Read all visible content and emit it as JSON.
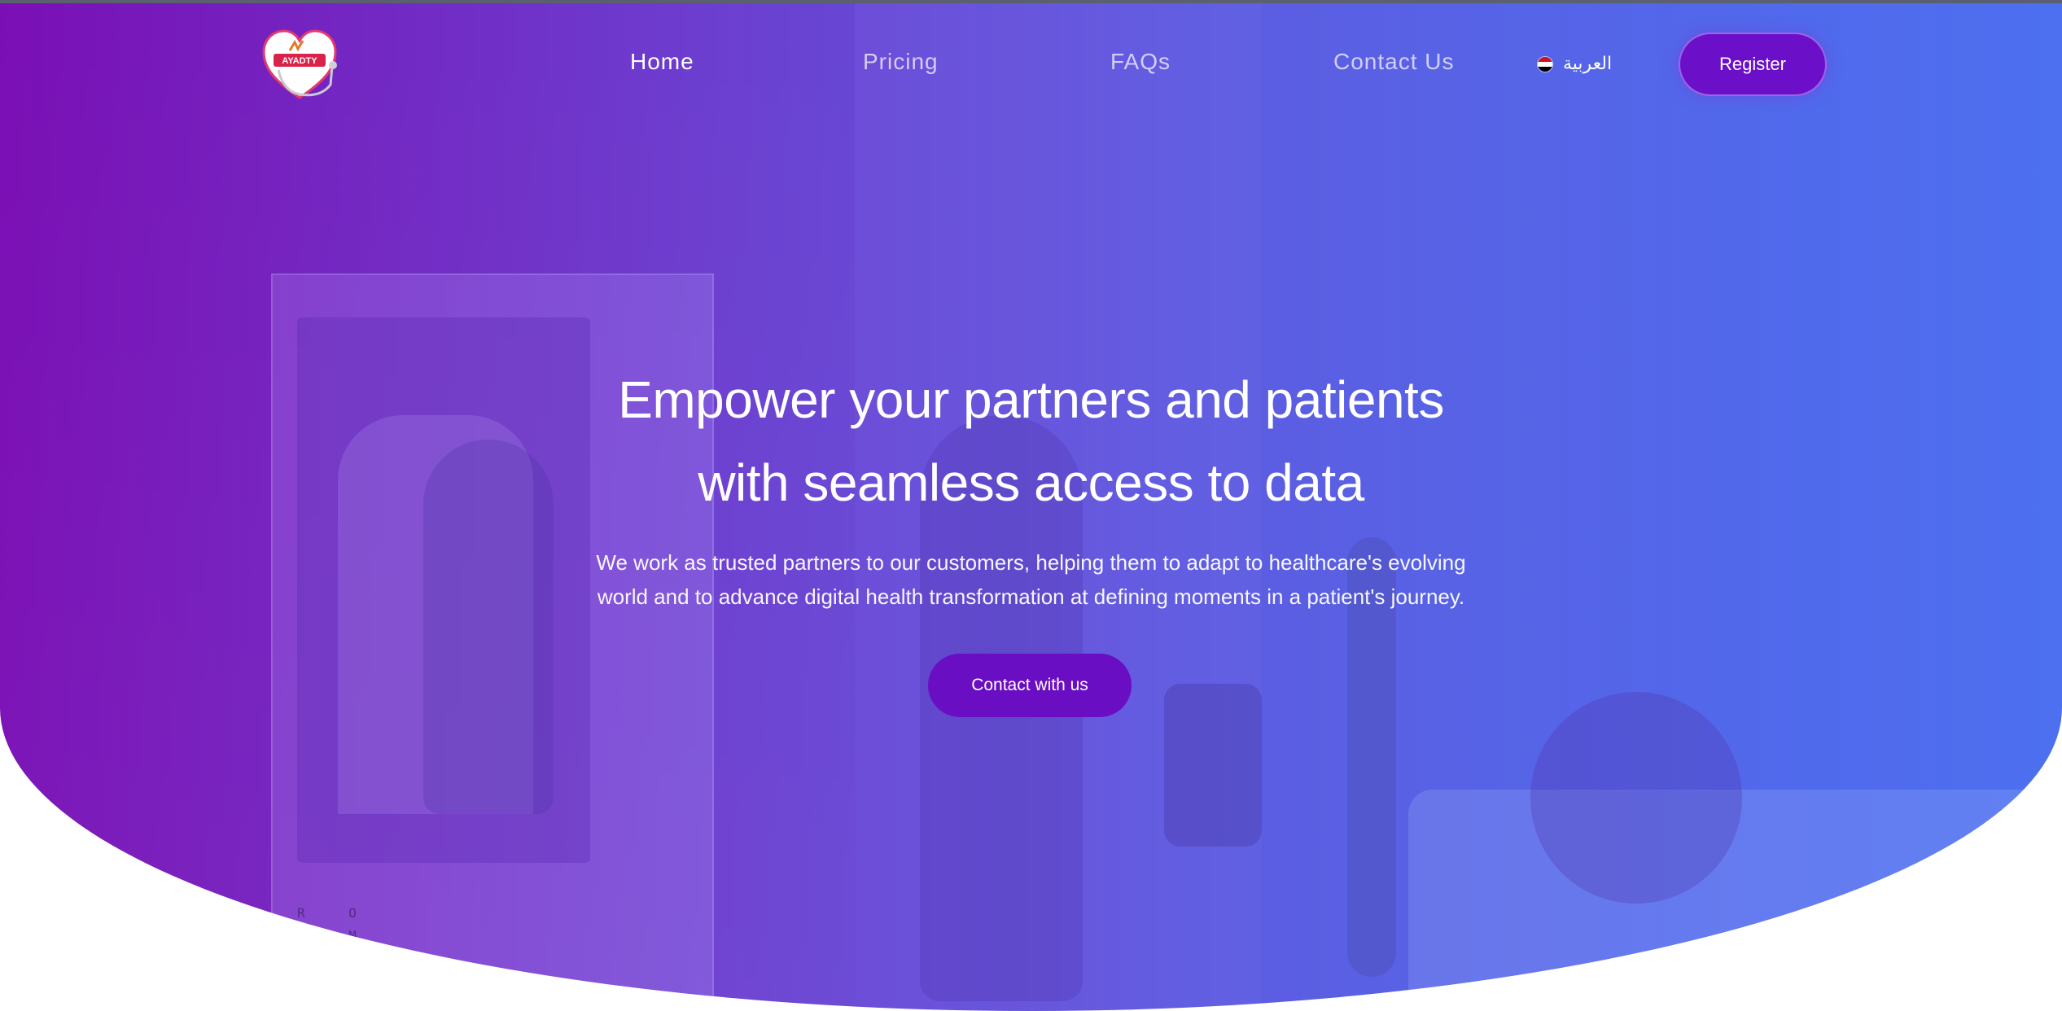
{
  "header": {
    "nav": [
      {
        "label": "Home",
        "active": true
      },
      {
        "label": "Pricing",
        "active": false
      },
      {
        "label": "FAQs",
        "active": false
      },
      {
        "label": "Contact Us",
        "active": false
      }
    ],
    "language": {
      "label": "العربية",
      "flag_icon": "egypt-flag-icon"
    },
    "register_label": "Register",
    "logo_icon": "heart-stethoscope-logo"
  },
  "hero": {
    "title_line1": "Empower your partners and patients",
    "title_line2": "with seamless access to data",
    "subtitle_line1": "We work as trusted partners to our customers, helping them to adapt to healthcare's evolving",
    "subtitle_line2": "world and to advance digital health transformation at defining moments in a patient's journey.",
    "cta_label": "Contact with us",
    "background_letters": [
      "R O",
      "O M"
    ]
  },
  "colors": {
    "gradient_start": "#7a0fb5",
    "gradient_end": "#4a6ff0",
    "button": "#6a0ec4",
    "text": "#ffffff"
  }
}
